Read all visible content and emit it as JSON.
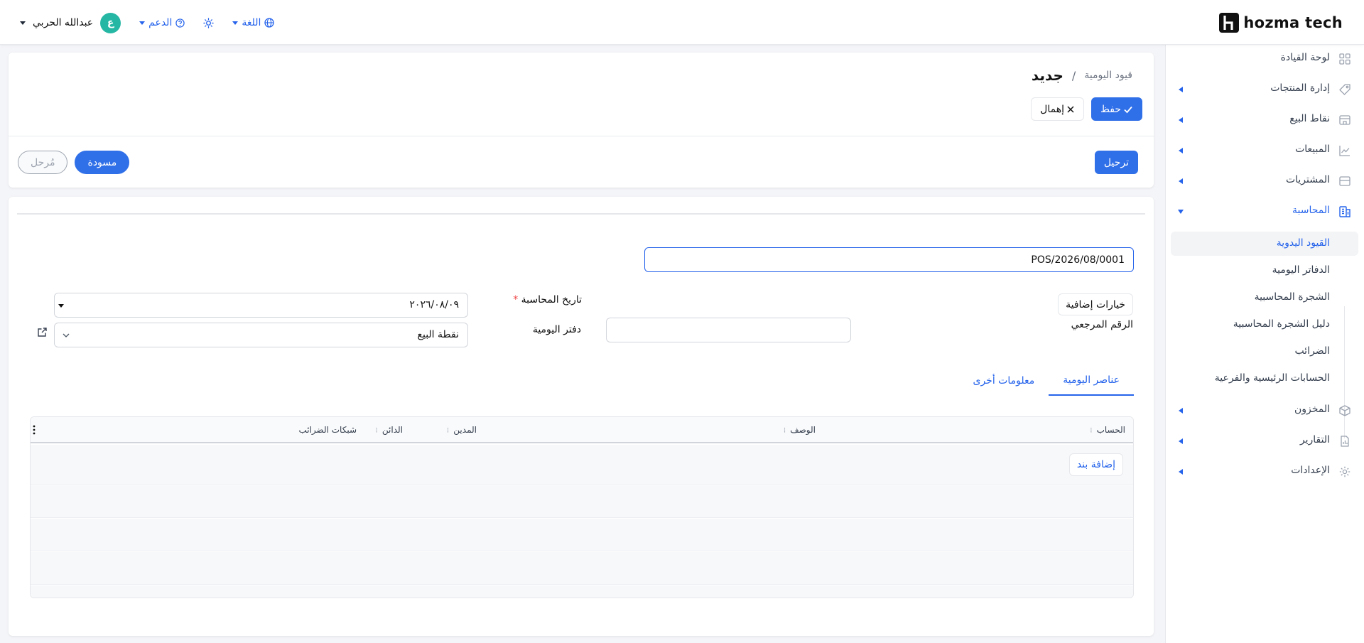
{
  "brand": {
    "name": "hozma tech"
  },
  "topbar": {
    "user_name": "عبدالله الحربي",
    "avatar_initial": "ع",
    "support_label": "الدعم",
    "language_label": "اللغة"
  },
  "sidebar": {
    "items": [
      {
        "label": "لوحة القيادة",
        "icon": "dashboard-icon"
      },
      {
        "label": "إدارة المنتجات",
        "icon": "tag-icon"
      },
      {
        "label": "نقاط البيع",
        "icon": "store-icon"
      },
      {
        "label": "المبيعات",
        "icon": "chart-line-icon"
      },
      {
        "label": "المشتريات",
        "icon": "archive-icon"
      },
      {
        "label": "المحاسبة",
        "icon": "accounting-icon"
      },
      {
        "label": "المخزون",
        "icon": "box-icon"
      },
      {
        "label": "التقارير",
        "icon": "report-icon"
      },
      {
        "label": "الإعدادات",
        "icon": "gear-icon"
      }
    ],
    "accounting_sub": [
      {
        "label": "القيود اليدوية"
      },
      {
        "label": "الدفاتر اليومية"
      },
      {
        "label": "الشجرة المحاسبية"
      },
      {
        "label": "دليل الشجرة المحاسبية"
      },
      {
        "label": "الضرائب"
      },
      {
        "label": "الحسابات الرئيسية والفرعية"
      }
    ]
  },
  "header": {
    "breadcrumb_parent": "قيود اليومية",
    "breadcrumb_separator": "/",
    "title": "جديد",
    "save_label": "حفظ",
    "discard_label": "إهمال",
    "post_label": "ترحيل",
    "status_draft": "مسودة",
    "status_posted": "مُرحل"
  },
  "form": {
    "name_value": "POS/2026/08/0001",
    "extra_options_label": "خيارات إضافية",
    "reference_label": "الرقم المرجعي",
    "accounting_date_label": "تاريخ المحاسبة",
    "required_mark": "*",
    "accounting_date_value": "٢٠٢٦/٠٨/٠٩",
    "journal_label": "دفتر اليومية",
    "journal_value": "نقطة البيع"
  },
  "tabs": [
    {
      "label": "عناصر اليومية",
      "active": true
    },
    {
      "label": "معلومات أخرى",
      "active": false
    }
  ],
  "grid": {
    "columns": {
      "account": "الحساب",
      "description": "الوصف",
      "debit": "المدين",
      "credit": "الدائن",
      "tax_grids": "شبكات الضرائب"
    },
    "add_line_label": "إضافة بند"
  },
  "colors": {
    "primary": "#2f6fe8",
    "accent_teal": "#26b7a4"
  }
}
